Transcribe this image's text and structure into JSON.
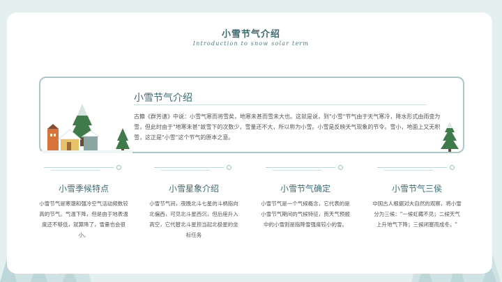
{
  "header": {
    "title": "小雪节气介绍",
    "subtitle": "Introduction to snow solar term"
  },
  "intro": {
    "heading": "小雪节气介绍",
    "body": "古籍《群芳谱》中说：小雪气寒而将雪矣，地寒未甚而雪未大也。这就是说，到\"小雪\"节气由于天气寒冷，降水形式由雨变为雪，但此时由于\"地寒未甚\"故雪下的次数少，雪量还不大，所以称为小雪。小雪是反映天气现象的节令。雪小，地面上又无积雪，这正是\"小雪\"这个节气的原本之意。"
  },
  "columns": [
    {
      "title": "小雪季候特点",
      "text": "小雪节气是寒潮和强冷空气活动频数较高的节气。气温下降，但是由于地表温度还不够低，就算降了，雪量也会很小。"
    },
    {
      "title": "小雪星象介绍",
      "text": "小雪节气间，夜晚北斗七星的斗柄指向北偏西，可见北斗星西沉，但后座升入高空，它代替北斗星担当起北极星的坐标任务"
    },
    {
      "title": "小雪节气确定",
      "text": "小雪节气是一个气候概念，它代表的是小雪节气期间的气候特征，而天气预报中的小雪则是指降雪强度较小的雪。"
    },
    {
      "title": "小雪节气三侯",
      "text": "中国古人根据对大自然的观察，将小雪分为三候：\"一候虹藏不见；二候天气上升地气下降；三候闭塞而成冬。\""
    }
  ],
  "colors": {
    "accent": "#3d6b72",
    "border": "#a9c8cc",
    "background": "#e4eff0"
  }
}
